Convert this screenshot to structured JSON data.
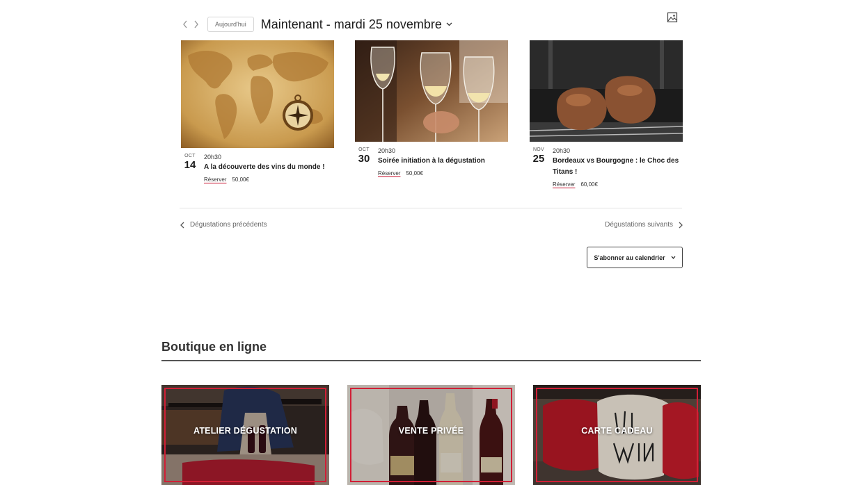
{
  "calendar": {
    "today_label": "Aujourd'hui",
    "range_title": "Maintenant - mardi 25 novembre",
    "icons": {
      "prev": "chevron-left-icon",
      "next": "chevron-right-icon",
      "view": "image-view-icon"
    }
  },
  "events": [
    {
      "month": "OCT",
      "day": "14",
      "time": "20h30",
      "title": "A la découverte des vins du monde !",
      "book_label": "Réserver",
      "price": "50,00€"
    },
    {
      "month": "OCT",
      "day": "30",
      "time": "20h30",
      "title": "Soirée initiation à la dégustation",
      "book_label": "Réserver",
      "price": "50,00€"
    },
    {
      "month": "NOV",
      "day": "25",
      "time": "20h30",
      "title": "Bordeaux vs Bourgogne : le Choc des Titans !",
      "book_label": "Réserver",
      "price": "60,00€"
    }
  ],
  "pagination": {
    "prev_label": "Dégustations précédents",
    "next_label": "Dégustations suivants"
  },
  "subscribe_label": "S'abonner au calendrier",
  "shop": {
    "title": "Boutique en ligne",
    "tiles": [
      {
        "label": "ATELIER DÉGUSTATION"
      },
      {
        "label": "VENTE PRIVÉE"
      },
      {
        "label": "CARTE CADEAU"
      }
    ]
  },
  "colors": {
    "accent": "#d11f36",
    "text": "#1c1c1c",
    "muted": "#666666"
  }
}
